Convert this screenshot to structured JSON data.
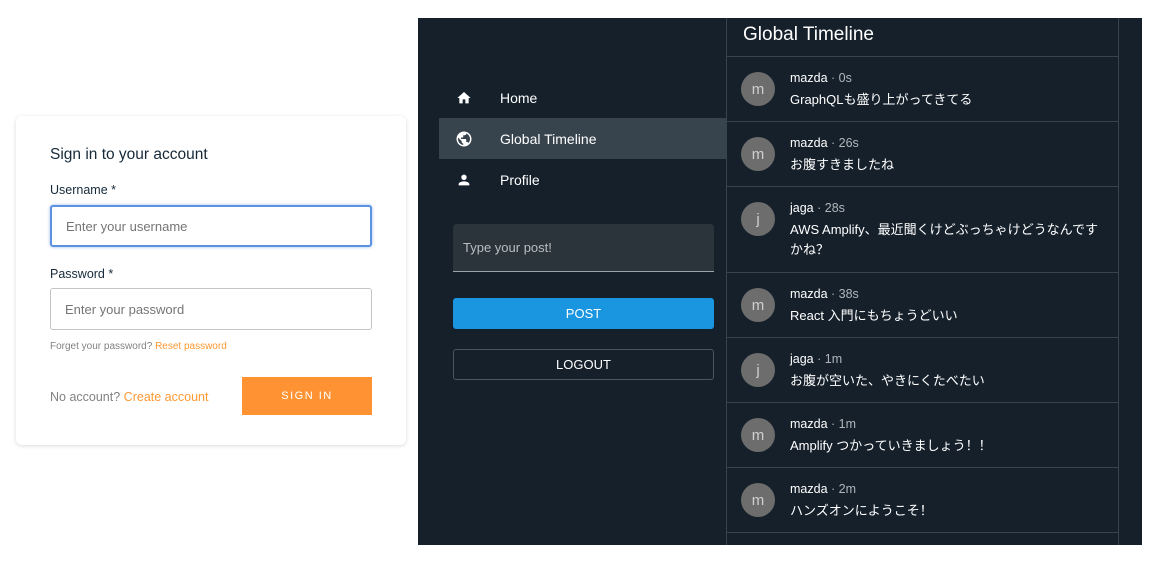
{
  "signin": {
    "title": "Sign in to your account",
    "username_label": "Username *",
    "username_placeholder": "Enter your username",
    "password_label": "Password *",
    "password_placeholder": "Enter your password",
    "forgot_text": "Forget your password? ",
    "reset_link": "Reset password",
    "no_account_text": "No account? ",
    "create_link": "Create account",
    "signin_button": "SIGN IN",
    "accent_color": "#ff9233"
  },
  "sidebar": {
    "items": [
      {
        "label": "Home",
        "icon": "home-icon"
      },
      {
        "label": "Global Timeline",
        "icon": "globe-icon",
        "active": true
      },
      {
        "label": "Profile",
        "icon": "person-icon"
      }
    ],
    "post_placeholder": "Type your post!",
    "post_button": "POST",
    "logout_button": "LOGOUT"
  },
  "timeline": {
    "title": "Global Timeline",
    "posts": [
      {
        "initial": "m",
        "user": "mazda",
        "time": "0s",
        "text": "GraphQLも盛り上がってきてる"
      },
      {
        "initial": "m",
        "user": "mazda",
        "time": "26s",
        "text": "お腹すきましたね"
      },
      {
        "initial": "j",
        "user": "jaga",
        "time": "28s",
        "text": "AWS Amplify、最近聞くけどぶっちゃけどうなんですかね？"
      },
      {
        "initial": "m",
        "user": "mazda",
        "time": "38s",
        "text": "React 入門にもちょうどいい"
      },
      {
        "initial": "j",
        "user": "jaga",
        "time": "1m",
        "text": "お腹が空いた、やきにくたべたい"
      },
      {
        "initial": "m",
        "user": "mazda",
        "time": "1m",
        "text": "Amplify つかっていきましょう！！"
      },
      {
        "initial": "m",
        "user": "mazda",
        "time": "2m",
        "text": "ハンズオンにようこそ！"
      }
    ],
    "separator": " · "
  }
}
